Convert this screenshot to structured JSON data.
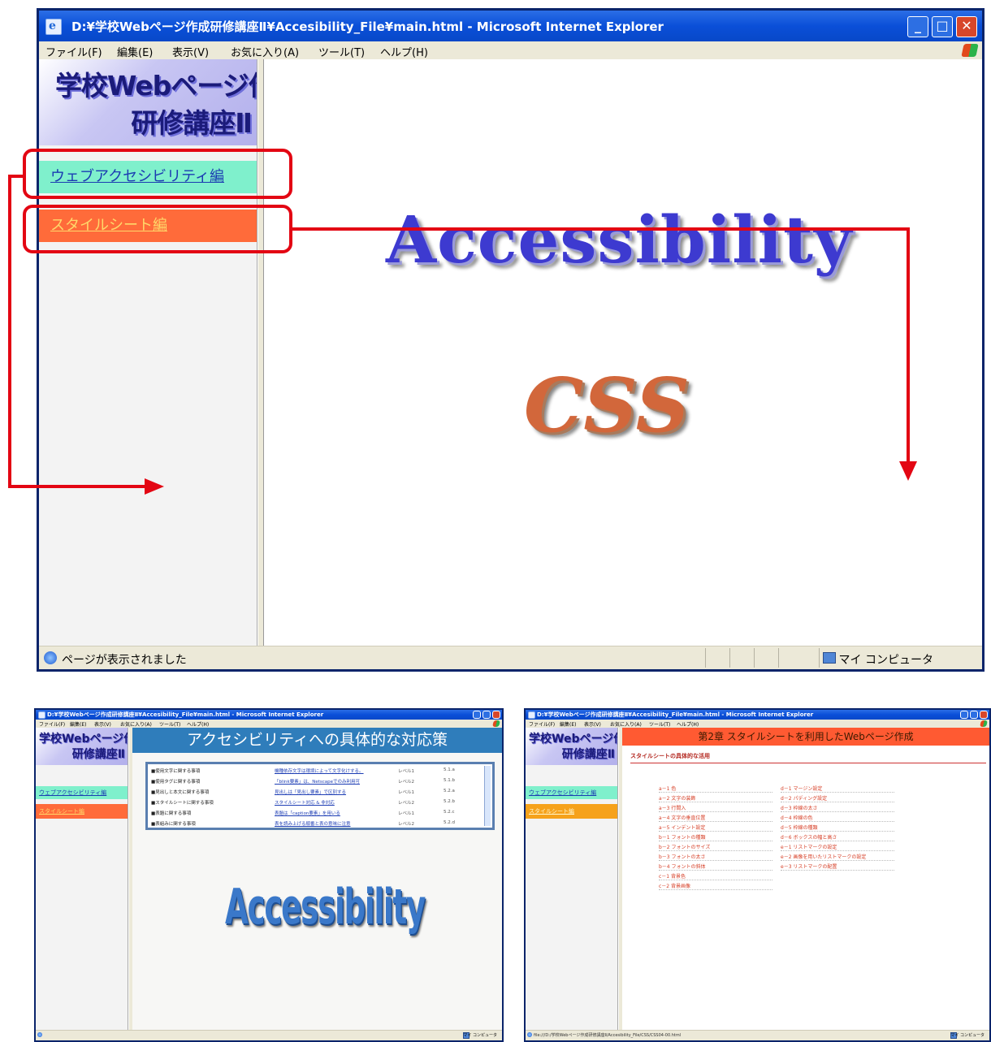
{
  "main_window": {
    "title": "D:¥学校Webページ作成研修講座Ⅱ¥Accesibility_File¥main.html - Microsoft Internet Explorer",
    "menu": [
      "ファイル(F)",
      "編集(E)",
      "表示(V)",
      "お気に入り(A)",
      "ツール(T)",
      "ヘルプ(H)"
    ],
    "logo_line1": "学校Webページ作成",
    "logo_line2": "研修講座Ⅱ",
    "nav": {
      "accessibility": "ウェブアクセシビリティ編",
      "stylesheet": "スタイルシート編"
    },
    "big_word_1": "Accessibility",
    "big_word_2": "CSS",
    "status": "ページが表示されました",
    "zone": "マイ コンピュータ"
  },
  "left_window": {
    "title": "D:¥学校Webページ作成研修講座Ⅱ¥Accesibility_File¥main.html - Microsoft Internet Explorer",
    "menu": [
      "ファイル(F)",
      "編集(E)",
      "表示(V)",
      "お気に入り(A)",
      "ツール(T)",
      "ヘルプ(H)"
    ],
    "logo_line1": "学校Webページ作成",
    "logo_line2": "研修講座Ⅱ",
    "nav": {
      "accessibility": "ウェブアクセシビリティ編",
      "stylesheet": "スタイルシート編"
    },
    "heading": "アクセシビリティへの具体的な対応策",
    "rows": [
      {
        "c1": "■使用文字に関する事項",
        "c2": "機種依存文字は環境によって文字化けする。",
        "c3": "レベル1",
        "c4": "5.1.a"
      },
      {
        "c1": "■使用タグに関する事項",
        "c2": "「blink要素」は、Netscapeでのみ利用可",
        "c3": "レベル2",
        "c4": "5.1.b"
      },
      {
        "c1": "■見出しと本文に関する事項",
        "c2": "見出しは「見出し要素」で区別する",
        "c3": "レベル1",
        "c4": "5.2.a"
      },
      {
        "c1": "■スタイルシートに関する事項",
        "c2": "スタイルシート対応 & 非対応",
        "c3": "レベル2",
        "c4": "5.2.b"
      },
      {
        "c1": "■表題に関する事項",
        "c2": "表題は「caption要素」を用いる",
        "c3": "レベル1",
        "c4": "5.2.c"
      },
      {
        "c1": "■表組みに関する事項",
        "c2": "表を読み上げる順番と表の意味に注意",
        "c3": "レベル2",
        "c4": "5.2.d"
      }
    ],
    "big_word": "Accessibility",
    "status": "",
    "zone": "マイ コンピュータ"
  },
  "right_window": {
    "title": "D:¥学校Webページ作成研修講座Ⅱ¥Accesibility_File¥main.html - Microsoft Internet Explorer",
    "menu": [
      "ファイル(F)",
      "編集(E)",
      "表示(V)",
      "お気に入り(A)",
      "ツール(T)",
      "ヘルプ(H)"
    ],
    "logo_line1": "学校Webページ作成",
    "logo_line2": "研修講座Ⅱ",
    "nav": {
      "accessibility": "ウェブアクセシビリティ編",
      "stylesheet": "スタイルシート編"
    },
    "heading": "第2章 スタイルシートを利用したWebページ作成",
    "subheading": "スタイルシートの具体的な活用",
    "items_left": [
      "a－1 色",
      "a－2 文字の装飾",
      "a－3 行間入",
      "a－4 文字の垂直位置",
      "a－5 インデント設定",
      "b－1 フォントの種類",
      "b－2 フォントのサイズ",
      "b－3 フォントの太さ",
      "b－4 フォントの斜体",
      "c－1 背景色",
      "c－2 背景画像"
    ],
    "items_right": [
      "d－1 マージン設定",
      "d－2 パディング設定",
      "d－3 枠線の太さ",
      "d－4 枠線の色",
      "d－5 枠線の種類",
      "d－6 ボックスの幅と高さ",
      "e－1 リストマークの設定",
      "e－2 画像を用いたリストマークの設定",
      "e－3 リストマークの配置"
    ],
    "status": "file:///D:/学校Webページ作成研修講座Ⅱ/Accesibility_File/CSS/CSS04-00.html",
    "zone": "マイ コンピュータ"
  },
  "colors": {
    "annotation": "#e30613",
    "nav_accessibility_bg": "#7ff0cc",
    "nav_stylesheet_bg": "#ff6b3a",
    "accessibility_word": "#3d3ad0",
    "css_word": "#d2673b"
  }
}
